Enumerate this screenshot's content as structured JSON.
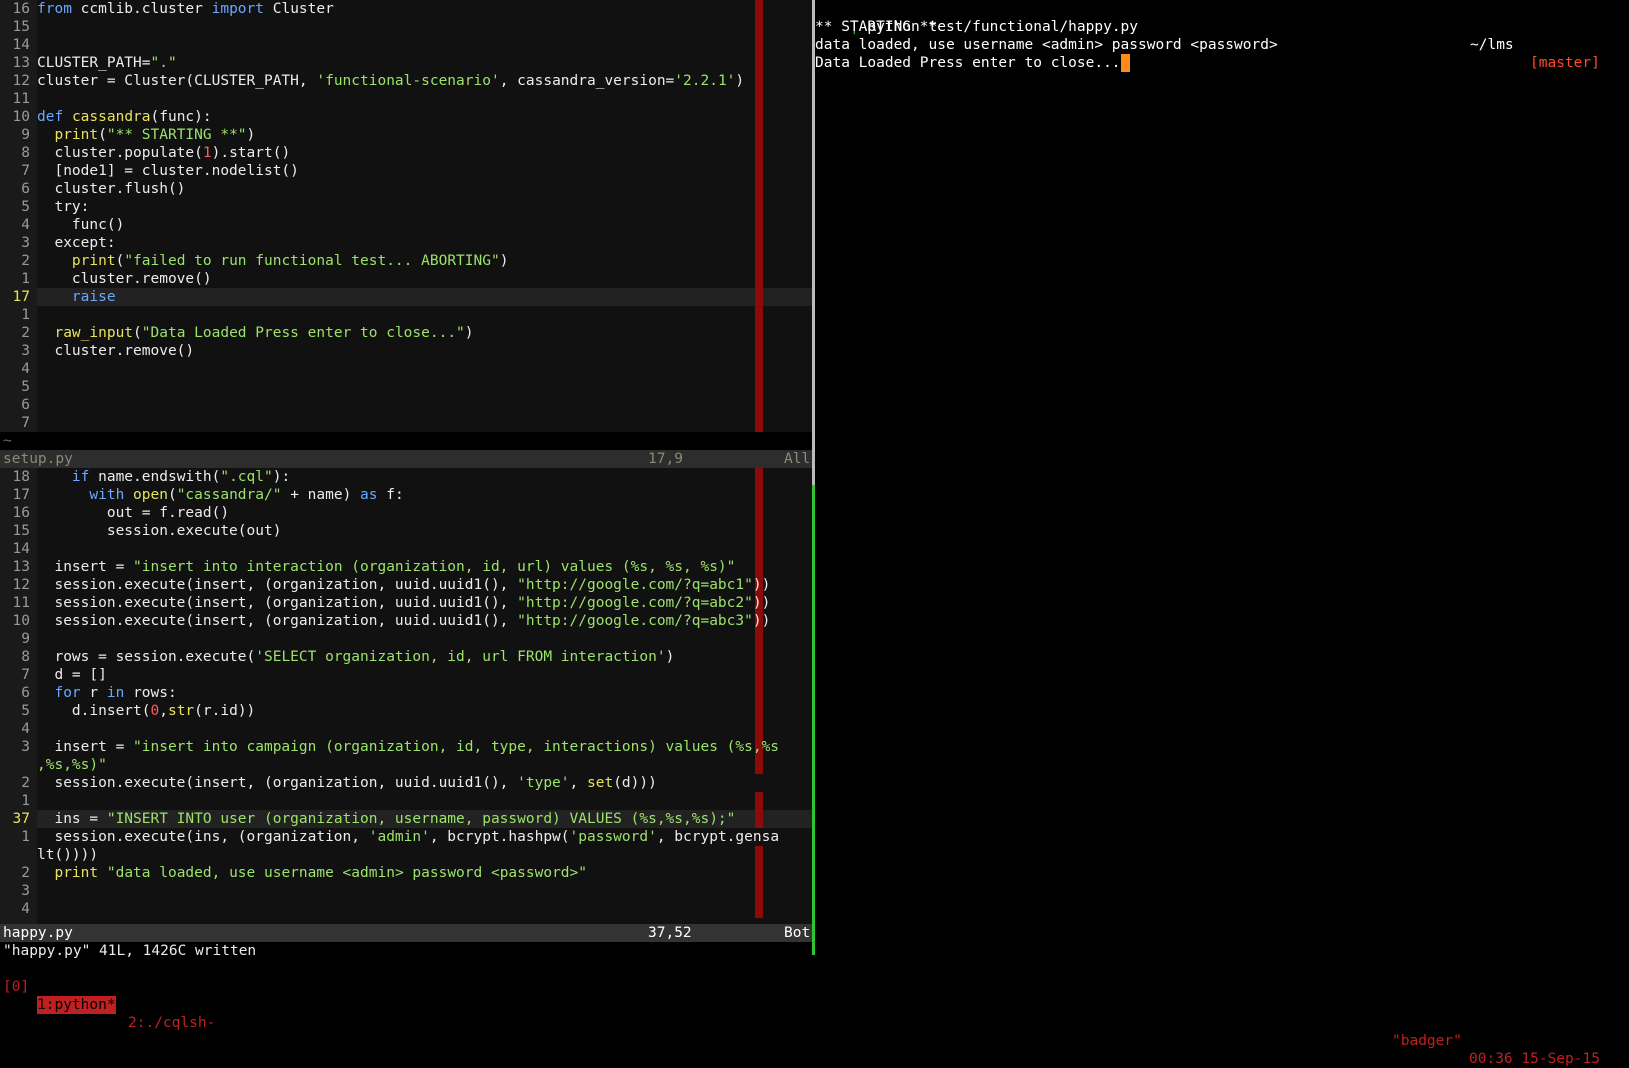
{
  "top_pane": {
    "lines": [
      {
        "n": "16",
        "html": "<span class='kw'>from</span> ccmlib.cluster <span class='kw'>import</span> Cluster"
      },
      {
        "n": "15",
        "html": ""
      },
      {
        "n": "14",
        "html": ""
      },
      {
        "n": "13",
        "html": "CLUSTER_PATH=<span class='st'>\".\"</span>"
      },
      {
        "n": "12",
        "html": "cluster = Cluster(CLUSTER_PATH, <span class='st'>'functional-scenario'</span>, cassandra_version=<span class='st'>'2.2.1'</span>)"
      },
      {
        "n": "11",
        "html": ""
      },
      {
        "n": "10",
        "html": "<span class='kw'>def</span> <span class='fn'>cassandra</span>(func):"
      },
      {
        "n": "9",
        "html": "  <span class='fn'>print</span>(<span class='st'>\"** STARTING **\"</span>)"
      },
      {
        "n": "8",
        "html": "  cluster.populate(<span class='nm'>1</span>).start()"
      },
      {
        "n": "7",
        "html": "  [node1] = cluster.nodelist()"
      },
      {
        "n": "6",
        "html": "  cluster.flush()"
      },
      {
        "n": "5",
        "html": "  try:"
      },
      {
        "n": "4",
        "html": "    func()"
      },
      {
        "n": "3",
        "html": "  except:"
      },
      {
        "n": "2",
        "html": "    <span class='fn'>print</span>(<span class='st'>\"failed to run functional test... ABORTING\"</span>)"
      },
      {
        "n": "1",
        "html": "    cluster.remove()"
      },
      {
        "n": "17",
        "html": "    <span class='kw'>raise</span>",
        "cur": true
      },
      {
        "n": "1",
        "html": ""
      },
      {
        "n": "2",
        "html": "  <span class='fn'>raw_input</span>(<span class='st'>\"Data Loaded Press enter to close...\"</span>)"
      },
      {
        "n": "3",
        "html": "  cluster.remove()"
      },
      {
        "n": "4",
        "html": ""
      },
      {
        "n": "5",
        "html": ""
      },
      {
        "n": "6",
        "html": ""
      },
      {
        "n": "7",
        "html": ""
      }
    ],
    "tilde": "~",
    "status_file": "setup.py",
    "status_pos": "17,9",
    "status_scroll": "All"
  },
  "bottom_pane": {
    "lines": [
      {
        "n": "18",
        "html": "    <span class='kw'>if</span> name.endswith(<span class='st'>\".cql\"</span>):"
      },
      {
        "n": "17",
        "html": "      <span class='kw'>with</span> <span class='fn'>open</span>(<span class='st'>\"cassandra/\"</span> + name) <span class='kw'>as</span> f:"
      },
      {
        "n": "16",
        "html": "        out = f.read()"
      },
      {
        "n": "15",
        "html": "        session.execute(out)"
      },
      {
        "n": "14",
        "html": ""
      },
      {
        "n": "13",
        "html": "  insert = <span class='st'>\"insert into interaction (organization, id, url) values (%s, %s, %s)\"</span>"
      },
      {
        "n": "12",
        "html": "  session.execute(insert, (organization, uuid.uuid1(), <span class='st'>\"http://google.com/?q=abc1\"</span>))"
      },
      {
        "n": "11",
        "html": "  session.execute(insert, (organization, uuid.uuid1(), <span class='st'>\"http://google.com/?q=abc2\"</span>))"
      },
      {
        "n": "10",
        "html": "  session.execute(insert, (organization, uuid.uuid1(), <span class='st'>\"http://google.com/?q=abc3\"</span>))"
      },
      {
        "n": "9",
        "html": ""
      },
      {
        "n": "8",
        "html": "  rows = session.execute(<span class='st'>'SELECT organization, id, url FROM interaction'</span>)"
      },
      {
        "n": "7",
        "html": "  d = []"
      },
      {
        "n": "6",
        "html": "  <span class='kw'>for</span> r <span class='kw'>in</span> rows:"
      },
      {
        "n": "5",
        "html": "    d.insert(<span class='nm'>0</span>,<span class='fn'>str</span>(r.id))"
      },
      {
        "n": "4",
        "html": ""
      },
      {
        "n": "3",
        "html": "  insert = <span class='st'>\"insert into campaign (organization, id, type, interactions) values (%s,%s</span>"
      },
      {
        "n": "",
        "html": "<span class='st'>,%s,%s)\"</span>"
      },
      {
        "n": "2",
        "html": "  session.execute(insert, (organization, uuid.uuid1(), <span class='st'>'type'</span>, <span class='fn'>set</span>(d)))"
      },
      {
        "n": "1",
        "html": ""
      },
      {
        "n": "37",
        "html": "  ins = <span class='st'>\"INSERT INTO user (organization, username, password) VALUES (%s,%s,%s);\"</span>",
        "cur": true
      },
      {
        "n": "1",
        "html": "  session.execute(ins, (organization, <span class='st'>'admin'</span>, bcrypt.hashpw(<span class='st'>'password'</span>, bcrypt.gensa"
      },
      {
        "n": "",
        "html": "lt())))"
      },
      {
        "n": "2",
        "html": "  <span class='fn'>print</span> <span class='st'>\"data loaded, use username &lt;admin&gt; password &lt;password&gt;\"</span>"
      },
      {
        "n": "3",
        "html": ""
      },
      {
        "n": "4",
        "html": ""
      }
    ],
    "status_file": "happy.py",
    "status_pos": "37,52",
    "status_scroll": "Bot"
  },
  "cmdline": "\"happy.py\" 41L, 1426C written",
  "terminal": {
    "prompt_bar": "|",
    "command": " python test/functional/happy.py",
    "cwd": "~/lms",
    "branch": "[master]",
    "output": [
      "** STARTING **",
      "data loaded, use username <admin> password <password>",
      "Data Loaded Press enter to close..."
    ]
  },
  "tmux": {
    "session": "[0]",
    "window_active": "1:python*",
    "window_other": "2:./cqlsh-",
    "host": "\"badger\"",
    "clock": "00:36 15-Sep-15"
  },
  "colors": {
    "keyword": "#6aa7ff",
    "function": "#e8e35a",
    "string": "#9be36a",
    "number": "#ff5a5a",
    "tmux": "#c02020",
    "cursor": "#ff8a1a"
  }
}
